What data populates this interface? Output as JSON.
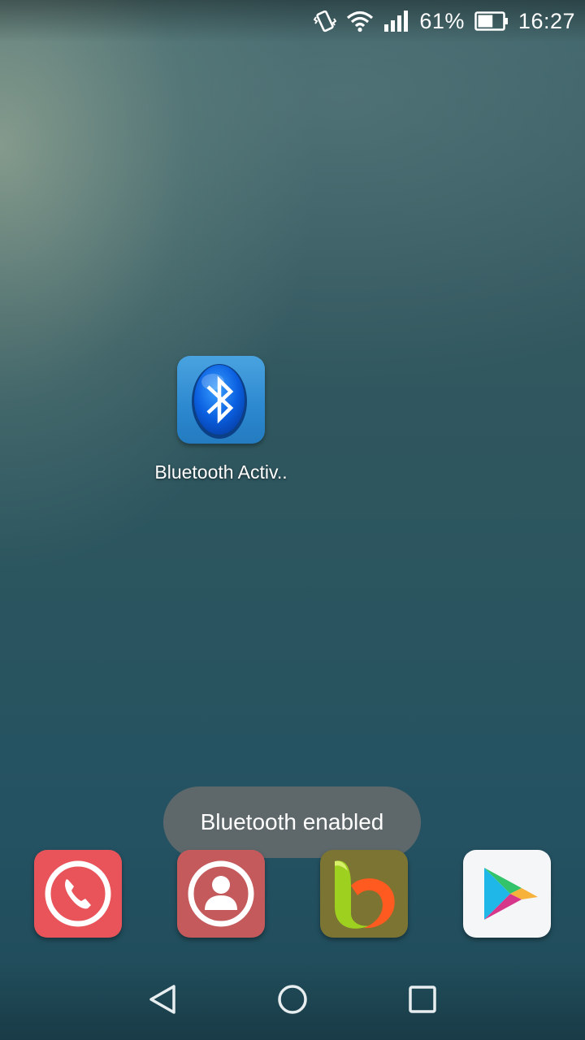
{
  "status_bar": {
    "icons": [
      "vibrate-icon",
      "wifi-icon",
      "signal-icon",
      "battery-icon"
    ],
    "battery_percent": "61%",
    "battery_level": 0.61,
    "time": "16:27"
  },
  "desktop_apps": [
    {
      "label": "Bluetooth Activ..",
      "icon": "bluetooth-icon"
    }
  ],
  "toast": {
    "message": "Bluetooth enabled"
  },
  "dock": [
    {
      "icon": "phone-icon",
      "color": "#e8545a"
    },
    {
      "icon": "contacts-icon",
      "color": "#c45a5c"
    },
    {
      "icon": "browser-icon",
      "color": "#7b7432"
    },
    {
      "icon": "play-store-icon",
      "color": "#f4f6f8"
    }
  ],
  "nav_bar": {
    "buttons": [
      "back-icon",
      "home-icon",
      "recent-apps-icon"
    ]
  }
}
